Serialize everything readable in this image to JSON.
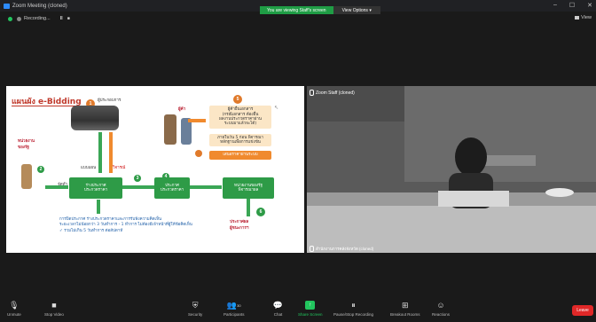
{
  "window": {
    "title": "Zoom Meeting (cloned)",
    "controls": [
      "–",
      "☐",
      "✕"
    ]
  },
  "banner": {
    "viewing_text": "You are viewing Staff's screen",
    "options_label": "View Options ▾"
  },
  "recording": {
    "label": "Recording...",
    "controls": [
      "II",
      "■"
    ]
  },
  "view": {
    "label": "View"
  },
  "slide": {
    "title": "แผนผัง e-Bidding",
    "labels": {
      "agency": "หน่วยงาน\nของรัฐ",
      "entrepreneur": "ผู้ประกอบการ",
      "bidder": "ผู้ค้า",
      "step_label_1": "จัดทำ",
      "invite": "แบบแผน",
      "criticize": "วิจารณ์",
      "announce_box": "ร่างประกาศ\nประกวดราคา",
      "announce_box2": "ประกาศ\nประกวดราคา",
      "vendor_box": "หน่วยงานของรัฐ\nพิจารณาผล",
      "result": "ประกาศผล\nผู้ชนะการฯ",
      "vendor_info": "ผู้ค้ายื่นเอกสาร\n(กรณีเอกสาร ต้องยื่น\nผลงานประกวดราคาผ่าน\nระบบมาแล้วจะได้)",
      "vendor_info2": "ภายในวัน 5 ก่อน พิจารณา\nหลักฐานเพื่อการแข่งขัน",
      "submit_price": "เสนอราคาผ่านระบบ",
      "note": "การปิดประกาศ ร่างประกวดราคาและการรับฟังความคิดเห็น\nระยะเวลาไม่น้อยกว่า 3 วันทำการ - 1 ทำการ ไม่ต้องมีเจ้าหน้าที่ผู้ให้ข้อคิดเห็น\n✓ รวมไม่เกิน 5 วันทำการ ต่อสัปดาห์",
      "nums": [
        "1",
        "2",
        "3",
        "4",
        "5",
        "6"
      ]
    }
  },
  "video": {
    "top_name": "Zoom Staff (cloned)",
    "bottom_name": "สำนักงานการคลังจังหวัด (cloned)"
  },
  "toolbar": {
    "items": [
      {
        "label": "Unmute",
        "icon": "mic-muted-icon"
      },
      {
        "label": "Stop Video",
        "icon": "video-icon"
      },
      {
        "label": "Security",
        "icon": "shield-icon"
      },
      {
        "label": "Participants",
        "icon": "participants-icon",
        "count": "30"
      },
      {
        "label": "Chat",
        "icon": "chat-icon"
      },
      {
        "label": "Share Screen",
        "icon": "share-screen-icon"
      },
      {
        "label": "Pause/Stop Recording",
        "icon": "record-icon"
      },
      {
        "label": "Breakout Rooms",
        "icon": "breakout-icon"
      },
      {
        "label": "Reactions",
        "icon": "reaction-icon"
      }
    ],
    "leave_label": "Leave"
  },
  "colors": {
    "share_green": "#1f9d45",
    "leave_red": "#e02828",
    "slide_orange": "#e07a2b",
    "slide_green": "#2e9b47"
  }
}
